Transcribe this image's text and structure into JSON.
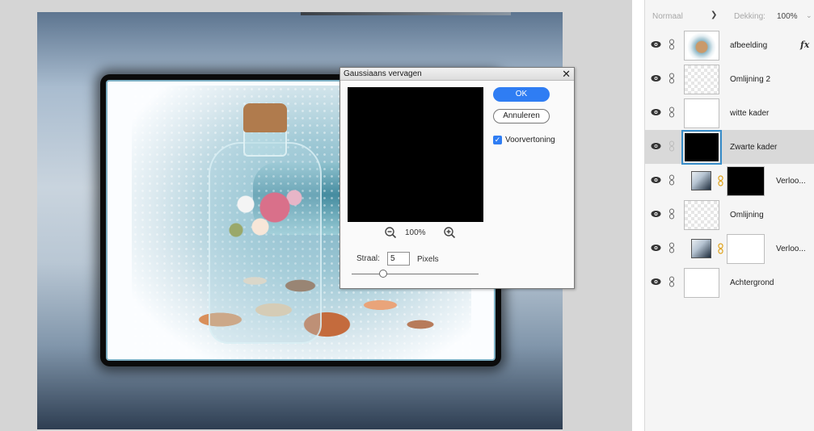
{
  "dialog": {
    "title": "Gaussiaans vervagen",
    "close_glyph": "✕",
    "zoom_level": "100%",
    "ok_label": "OK",
    "cancel_label": "Annuleren",
    "preview_checked": true,
    "preview_label": "Voorvertoning",
    "radius_label": "Straal:",
    "radius_value": "5",
    "radius_unit": "Pixels",
    "radius_slider_fraction": 0.25
  },
  "layers": {
    "blend_mode": "Normaal",
    "opacity_label": "Dekking:",
    "opacity_value": "100%",
    "items": [
      {
        "name": "afbeelding",
        "fx": "fx",
        "selected": false,
        "thumb": "image"
      },
      {
        "name": "Omlijning 2",
        "selected": false,
        "thumb": "transparent"
      },
      {
        "name": "witte kader",
        "selected": false,
        "thumb": "white"
      },
      {
        "name": "Zwarte kader",
        "selected": true,
        "thumb": "black"
      },
      {
        "name": "Verloo...",
        "selected": false,
        "thumb": "gradient-fill",
        "mask": "black"
      },
      {
        "name": "Omlijning",
        "selected": false,
        "thumb": "transparent"
      },
      {
        "name": "Verloo...",
        "selected": false,
        "thumb": "gradient-fill",
        "mask": "white"
      },
      {
        "name": "Achtergrond",
        "selected": false,
        "thumb": "white"
      }
    ]
  },
  "colors": {
    "accent": "#2f7df3",
    "selected_row": "#d9d9d9",
    "selected_thumb_outline": "#3a8fcb"
  }
}
